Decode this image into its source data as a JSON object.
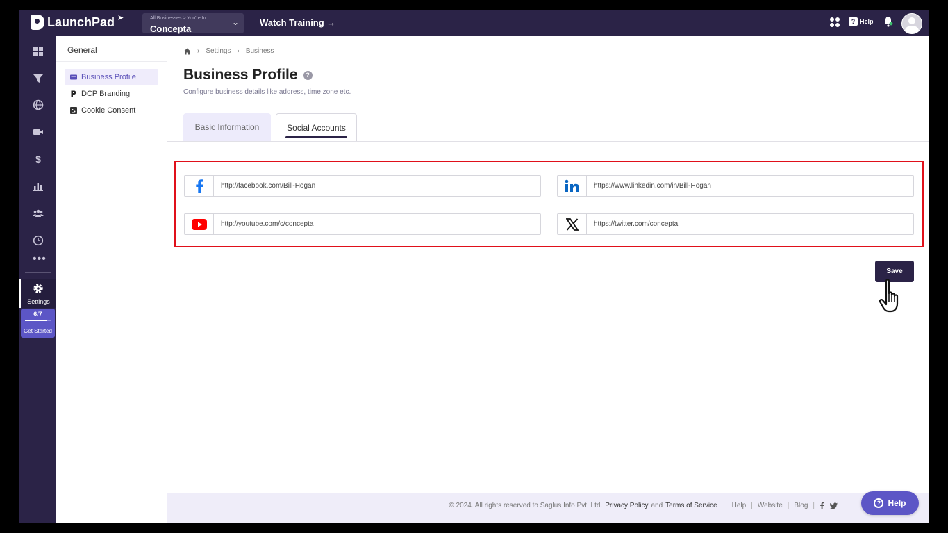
{
  "brand": {
    "name": "LaunchPad"
  },
  "business_selector": {
    "crumb": "All Businesses > You're In",
    "value": "Concepta"
  },
  "topbar": {
    "watch_training": "Watch Training →",
    "help_label": "Help"
  },
  "rail": {
    "items": [
      "dashboard-icon",
      "funnel-icon",
      "globe-icon",
      "video-icon",
      "dollar-icon",
      "chart-icon",
      "users-icon",
      "clock-icon",
      "more-icon"
    ],
    "settings_label": "Settings",
    "get_started": {
      "count": "6/7",
      "progress": 0.857,
      "label": "Get Started"
    }
  },
  "subnav": {
    "title": "General",
    "items": [
      {
        "label": "Business Profile",
        "icon": "id-card-icon",
        "active": true
      },
      {
        "label": "DCP Branding",
        "icon": "brand-p-icon",
        "active": false
      },
      {
        "label": "Cookie Consent",
        "icon": "cookie-icon",
        "active": false
      }
    ]
  },
  "breadcrumb": {
    "home_icon": "home-icon",
    "items": [
      "Settings",
      "Business"
    ]
  },
  "page": {
    "title": "Business Profile",
    "subtitle": "Configure business details like address, time zone etc."
  },
  "tabs": [
    {
      "label": "Basic Information",
      "active": false
    },
    {
      "label": "Social Accounts",
      "active": true
    }
  ],
  "social": {
    "facebook": {
      "icon": "facebook-icon",
      "value": "http://facebook.com/Bill-Hogan"
    },
    "linkedin": {
      "icon": "linkedin-icon",
      "value": "https://www.linkedin.com/in/Bill-Hogan"
    },
    "youtube": {
      "icon": "youtube-icon",
      "value": "http://youtube.com/c/concepta"
    },
    "twitter": {
      "icon": "x-twitter-icon",
      "value": "https://twitter.com/concepta"
    }
  },
  "save_label": "Save",
  "footer": {
    "copyright": "©  2024. All rights reserved to Saglus Info Pvt. Ltd.",
    "privacy": "Privacy Policy",
    "and": "and",
    "terms": "Terms of Service",
    "links": [
      "Help",
      "Website",
      "Blog"
    ]
  },
  "help_button": "Help",
  "colors": {
    "nav_dark": "#2b2347",
    "accent": "#5c56c6",
    "highlight_border": "#e0101a"
  }
}
